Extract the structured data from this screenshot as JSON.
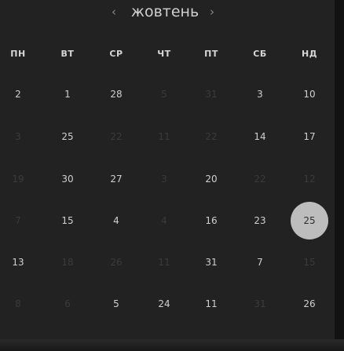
{
  "header": {
    "month": "жовтень",
    "prev_icon": "‹",
    "next_icon": "›"
  },
  "weekdays": [
    "ПН",
    "ВТ",
    "СР",
    "ЧТ",
    "ПТ",
    "СБ",
    "НД"
  ],
  "weeks": [
    [
      {
        "text": "2",
        "muted": false
      },
      {
        "text": "1",
        "muted": false
      },
      {
        "text": "28",
        "muted": false
      },
      {
        "text": "5",
        "muted": true
      },
      {
        "text": "31",
        "muted": true
      },
      {
        "text": "3",
        "muted": false
      },
      {
        "text": "10",
        "muted": false
      }
    ],
    [
      {
        "text": "3",
        "muted": true
      },
      {
        "text": "25",
        "muted": false
      },
      {
        "text": "22",
        "muted": true
      },
      {
        "text": "11",
        "muted": true
      },
      {
        "text": "22",
        "muted": true
      },
      {
        "text": "14",
        "muted": false
      },
      {
        "text": "17",
        "muted": false
      }
    ],
    [
      {
        "text": "19",
        "muted": true
      },
      {
        "text": "30",
        "muted": false
      },
      {
        "text": "27",
        "muted": false
      },
      {
        "text": "3",
        "muted": true
      },
      {
        "text": "20",
        "muted": false
      },
      {
        "text": "22",
        "muted": true
      },
      {
        "text": "12",
        "muted": true
      }
    ],
    [
      {
        "text": "7",
        "muted": true
      },
      {
        "text": "15",
        "muted": false
      },
      {
        "text": "4",
        "muted": false
      },
      {
        "text": "4",
        "muted": true
      },
      {
        "text": "16",
        "muted": false
      },
      {
        "text": "23",
        "muted": false
      },
      {
        "text": "25",
        "muted": false,
        "selected": true
      }
    ],
    [
      {
        "text": "13",
        "muted": false
      },
      {
        "text": "18",
        "muted": true
      },
      {
        "text": "26",
        "muted": true
      },
      {
        "text": "11",
        "muted": true
      },
      {
        "text": "31",
        "muted": false
      },
      {
        "text": "7",
        "muted": false
      },
      {
        "text": "15",
        "muted": true
      }
    ],
    [
      {
        "text": "8",
        "muted": true
      },
      {
        "text": "6",
        "muted": true
      },
      {
        "text": "5",
        "muted": false
      },
      {
        "text": "24",
        "muted": false
      },
      {
        "text": "11",
        "muted": false
      },
      {
        "text": "31",
        "muted": true
      },
      {
        "text": "26",
        "muted": false
      }
    ]
  ],
  "colors": {
    "panel": "#222222",
    "text": "#cfcfcf",
    "muted": "#3a3a3a",
    "selected_bg": "#bdbdbd"
  }
}
